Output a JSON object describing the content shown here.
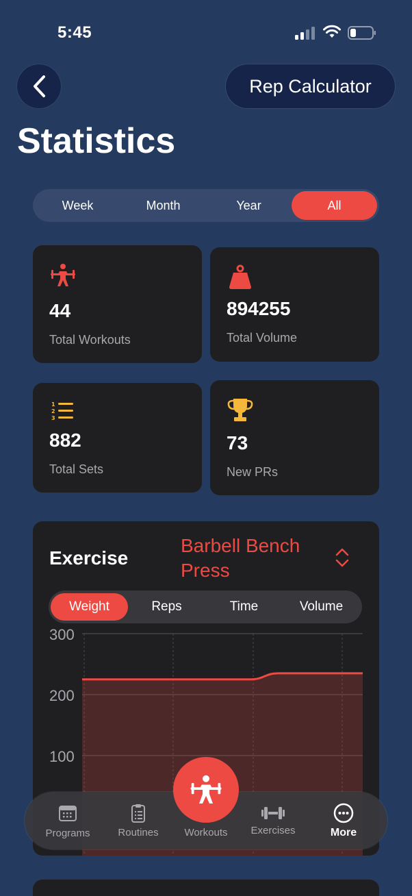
{
  "status_bar": {
    "time": "5:45"
  },
  "header": {
    "title": "Statistics",
    "rep_calculator_label": "Rep Calculator"
  },
  "period_tabs": {
    "items": [
      "Week",
      "Month",
      "Year",
      "All"
    ],
    "selected": "All"
  },
  "stats": {
    "total_workouts": {
      "value": "44",
      "label": "Total Workouts",
      "icon": "weightlifter-icon"
    },
    "total_volume": {
      "value": "894255",
      "label": "Total Volume",
      "icon": "kettlebell-weight-icon"
    },
    "total_sets": {
      "value": "882",
      "label": "Total Sets",
      "icon": "numbered-list-icon"
    },
    "new_prs": {
      "value": "73",
      "label": "New PRs",
      "icon": "trophy-icon"
    }
  },
  "exercise": {
    "label": "Exercise",
    "selected_name": "Barbell Bench Press",
    "metric_tabs": [
      "Weight",
      "Reps",
      "Time",
      "Volume"
    ],
    "selected_metric": "Weight"
  },
  "chart_data": {
    "type": "area",
    "title": "",
    "xlabel": "",
    "ylabel": "",
    "ylim": [
      0,
      300
    ],
    "yticks": [
      100,
      200,
      300
    ],
    "grid": true,
    "x": [
      0,
      1,
      2,
      3,
      4,
      5,
      6,
      7,
      8,
      9,
      10
    ],
    "series": [
      {
        "values": [
          225,
          225,
          225,
          225,
          225,
          225,
          225,
          235,
          235,
          235,
          235
        ]
      }
    ]
  },
  "tab_bar": {
    "items": [
      {
        "label": "Programs",
        "icon": "calendar-icon"
      },
      {
        "label": "Routines",
        "icon": "clipboard-icon"
      },
      {
        "label": "Workouts",
        "icon": "weightlifter-icon"
      },
      {
        "label": "Exercises",
        "icon": "dumbbell-icon"
      },
      {
        "label": "More",
        "icon": "ellipsis-circle-icon"
      }
    ],
    "selected": "More"
  },
  "colors": {
    "background": "#253a5f",
    "accent": "#ec4a43",
    "card": "#1f1f21",
    "trophy": "#f5b73b"
  }
}
